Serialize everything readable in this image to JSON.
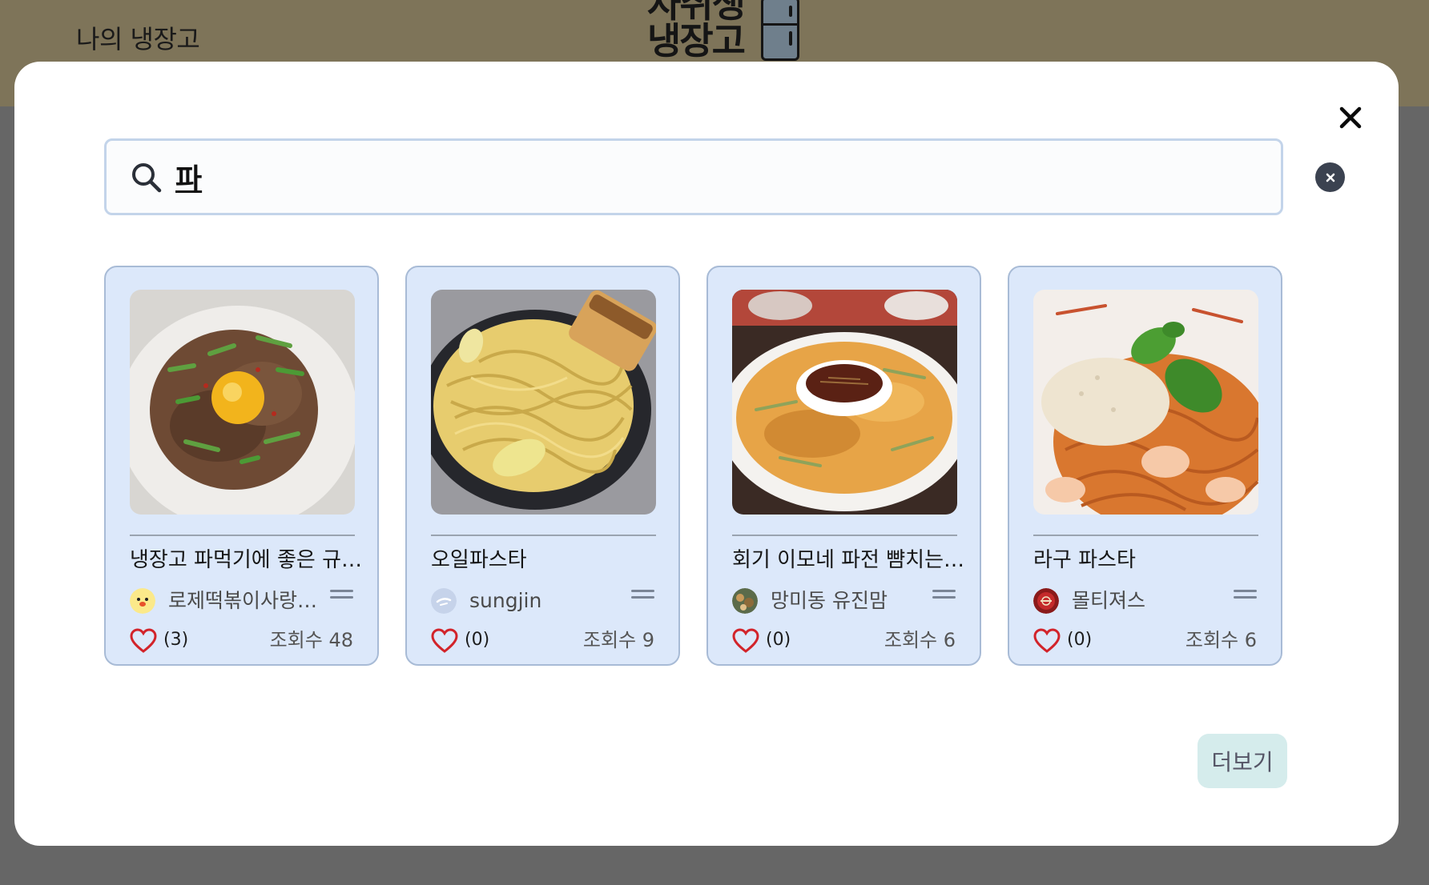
{
  "header": {
    "title": "나의 냉장고",
    "logo_line1": "자취생",
    "logo_line2": "냉장고"
  },
  "search": {
    "query": "파",
    "icon": "search-icon",
    "clear_icon": "clear-icon"
  },
  "close_icon": "close-icon",
  "results": [
    {
      "title": "냉장고 파먹기에 좋은 규…",
      "author": "로제떡볶이사랑…",
      "likes": "(3)",
      "views": "조회수 48",
      "image": "beef-rice-bowl-egg-yolk"
    },
    {
      "title": "오일파스타",
      "author": "sungjin",
      "likes": "(0)",
      "views": "조회수 9",
      "image": "oil-pasta-garlic-bread"
    },
    {
      "title": "회기 이모네 파전 뺨치는…",
      "author": "망미동 유진맘",
      "likes": "(0)",
      "views": "조회수 6",
      "image": "green-onion-pancake-dipping-sauce"
    },
    {
      "title": "라구 파스타",
      "author": "몰티져스",
      "likes": "(0)",
      "views": "조회수 6",
      "image": "shrimp-spaghetti-basil-parmesan"
    }
  ],
  "more_label": "더보기",
  "colors": {
    "header_bg": "#7e7459",
    "overlay": "#666666",
    "card_bg": "#dce8fa",
    "card_border": "#a8bbd6",
    "search_border": "#c3d4ea",
    "more_bg": "#d5ecec",
    "heart": "#d2232a"
  }
}
